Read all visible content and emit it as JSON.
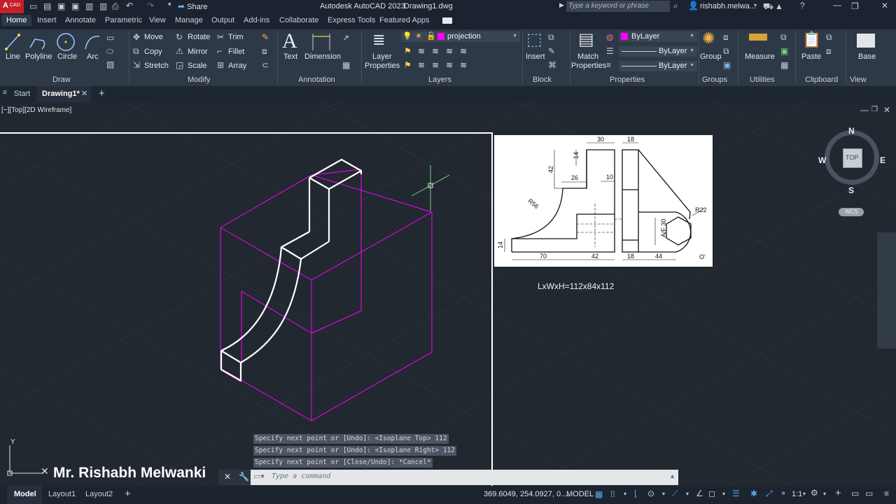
{
  "title_bar": {
    "app_badge": "CAD",
    "share_label": "Share",
    "title": "Autodesk AutoCAD 2023",
    "document": "Drawing1.dwg",
    "search_placeholder": "Type a keyword or phrase",
    "user": "rishabh.melwa..."
  },
  "ribbon_tabs": [
    "Home",
    "Insert",
    "Annotate",
    "Parametric",
    "View",
    "Manage",
    "Output",
    "Add-ins",
    "Collaborate",
    "Express Tools",
    "Featured Apps"
  ],
  "draw": {
    "line": "Line",
    "polyline": "Polyline",
    "circle": "Circle",
    "arc": "Arc",
    "title": "Draw"
  },
  "modify": {
    "move": "Move",
    "rotate": "Rotate",
    "trim": "Trim",
    "copy": "Copy",
    "mirror": "Mirror",
    "fillet": "Fillet",
    "stretch": "Stretch",
    "scale": "Scale",
    "array": "Array",
    "title": "Modify"
  },
  "annotation": {
    "text": "Text",
    "dimension": "Dimension",
    "title": "Annotation"
  },
  "layers": {
    "layer_properties_1": "Layer",
    "layer_properties_2": "Properties",
    "current_layer": "projection",
    "title": "Layers"
  },
  "block": {
    "insert": "Insert",
    "title": "Block"
  },
  "properties": {
    "match_1": "Match",
    "match_2": "Properties",
    "color": "ByLayer",
    "linetype": "ByLayer",
    "lineweight": "ByLayer",
    "title": "Properties"
  },
  "groups": {
    "group": "Group",
    "title": "Groups"
  },
  "utilities": {
    "measure": "Measure",
    "title": "Utilities"
  },
  "clipboard": {
    "paste": "Paste",
    "title": "Clipboard"
  },
  "view_panel": {
    "base": "Base",
    "title": "View"
  },
  "file_tabs": {
    "start": "Start",
    "drawing": "Drawing1*"
  },
  "viewport_label": "[−][Top][2D Wireframe]",
  "viewcube": {
    "n": "N",
    "s": "S",
    "e": "E",
    "w": "W",
    "face": "TOP",
    "wcs": "WCS"
  },
  "reference_drawing": {
    "dims": [
      "30",
      "18",
      "14",
      "42",
      "26",
      "10",
      "R56",
      "R22",
      "A/F 30",
      "14",
      "70",
      "42",
      "18",
      "44",
      "O'"
    ]
  },
  "dimension_note": "LxWxH=112x84x112",
  "command_history": [
    "Specify next point or [Undo]:  <Isoplane Top> 112",
    "Specify next point or [Undo]:  <Isoplane Right> 112",
    "Specify next point or [Close/Undo]: *Cancel*"
  ],
  "command_placeholder": "Type a command",
  "watermark": "Mr. Rishabh Melwanki",
  "layout_tabs": [
    "Model",
    "Layout1",
    "Layout2"
  ],
  "status": {
    "coords": "369.6049, 254.0927, 0....",
    "mode": "MODEL",
    "scale": "1:1"
  },
  "colors": {
    "accent": "#d6a33a",
    "layer_magenta": "#ff00ff",
    "ribbon_bg": "#2e3948",
    "canvas_bg": "#212830"
  }
}
